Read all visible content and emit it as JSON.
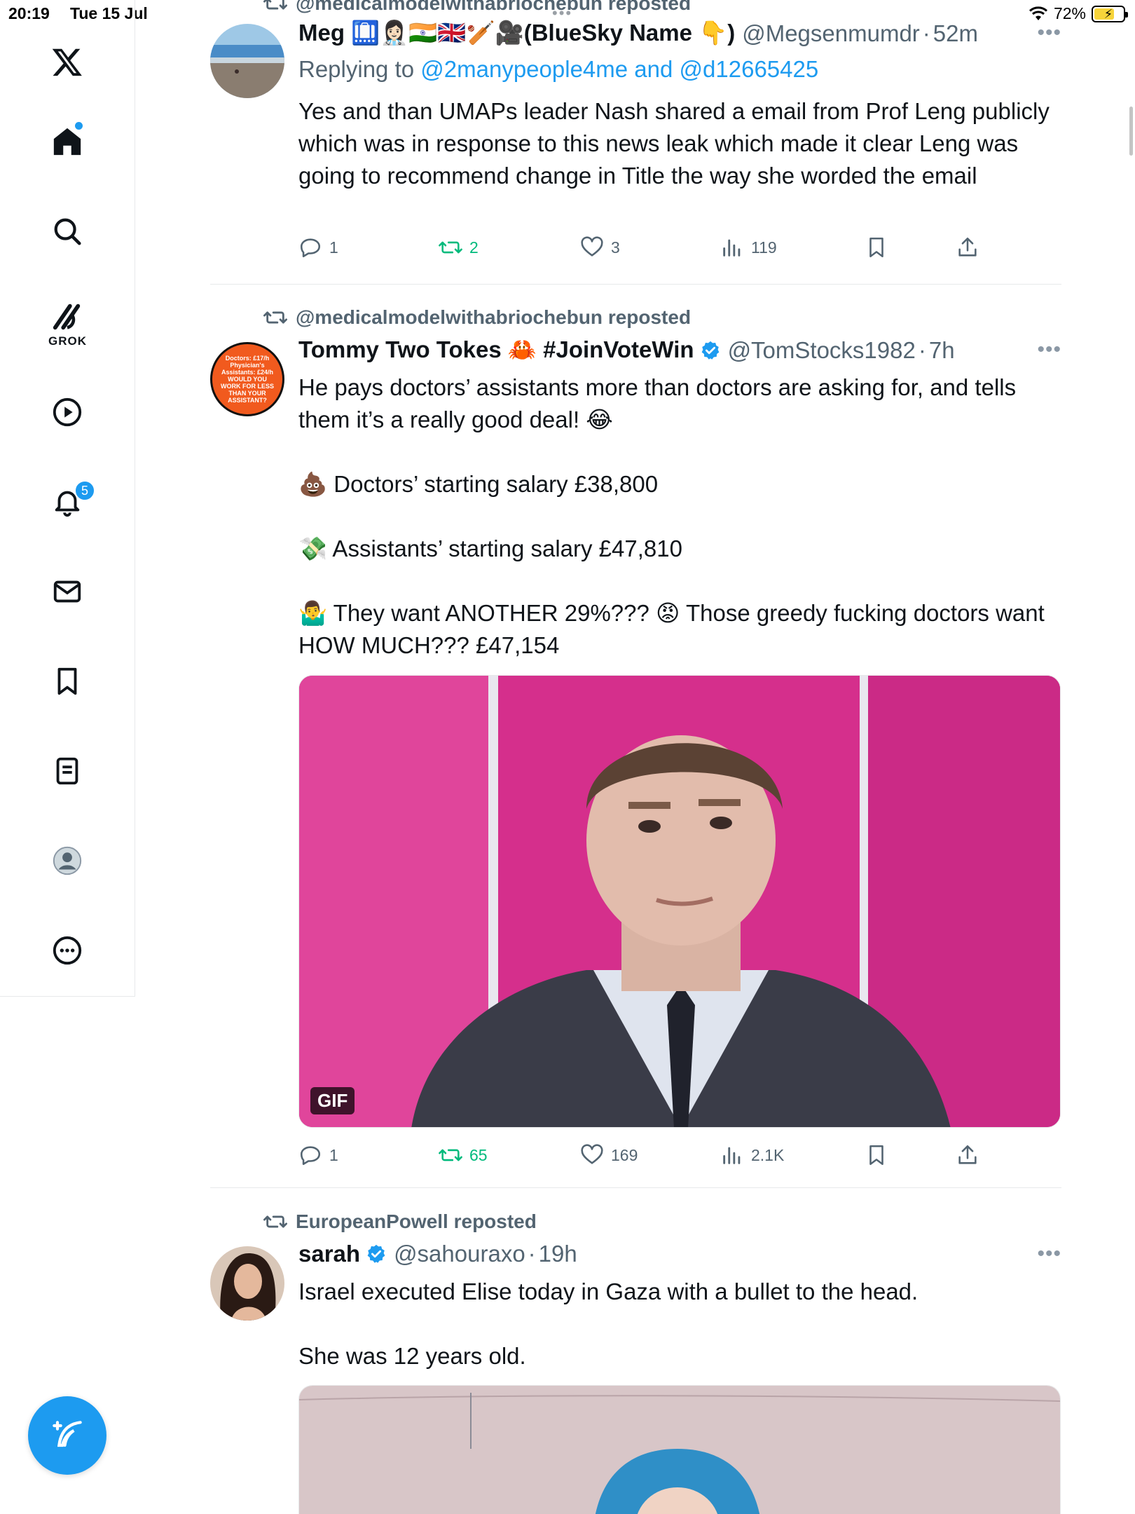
{
  "status_bar": {
    "time": "20:19",
    "date": "Tue 15 Jul",
    "battery": "72%",
    "battery_level": 0.72
  },
  "sidebar": {
    "grok_label": "GROK",
    "notifications_badge": "5",
    "icons": [
      "x-logo-icon",
      "home-icon",
      "search-icon",
      "grok-icon",
      "video-icon",
      "bell-icon",
      "mail-icon",
      "bookmark-icon",
      "lists-icon",
      "profile-icon",
      "more-icon"
    ]
  },
  "tweets": [
    {
      "repost_by": "@medicalmodelwithabriochebun reposted",
      "name": "Meg 🛄👩🏻‍⚕️🇮🇳🇬🇧🏏🎥(BlueSky Name 👇)",
      "handle": "@Megsenmumdr",
      "time": "52m",
      "reply_prefix": "Replying to",
      "reply_user1": "@2manypeople4me",
      "reply_and": "and",
      "reply_user2": "@d12665425",
      "text": "Yes and than UMAPs leader Nash shared a email from Prof Leng publicly which was in response to this news leak which made it clear Leng was going to recommend change in Title the way she worded the email",
      "replies": "1",
      "reposts": "2",
      "likes": "3",
      "views": "119"
    },
    {
      "repost_by": "@medicalmodelwithabriochebun reposted",
      "name": "Tommy Two Tokes 🦀 #JoinVoteWin",
      "handle": "@TomStocks1982",
      "time": "7h",
      "avatar_text": "Doctors: £17/h Physician's Assistants: £24/h WOULD YOU WORK FOR LESS THAN YOUR ASSISTANT?",
      "text": "He pays doctors’ assistants more than doctors are asking for, and tells them it’s a really good deal! 😂\n\n💩 Doctors’ starting salary £38,800\n\n💸 Assistants’ starting salary £47,810\n\n🤷‍♂️ They want ANOTHER 29%??? 😡 Those greedy fucking doctors want HOW MUCH??? £47,154",
      "media_label": "GIF",
      "replies": "1",
      "reposts": "65",
      "likes": "169",
      "views": "2.1K"
    },
    {
      "repost_by": "EuropeanPowell reposted",
      "name": "sarah",
      "handle": "@sahouraxo",
      "time": "19h",
      "text": "Israel executed Elise today in Gaza with a bullet to the head.\n\nShe was 12 years old."
    }
  ],
  "colors": {
    "accent": "#1d9bf0",
    "repost_green": "#00ba7c",
    "muted": "#536471",
    "text": "#0f1419"
  }
}
